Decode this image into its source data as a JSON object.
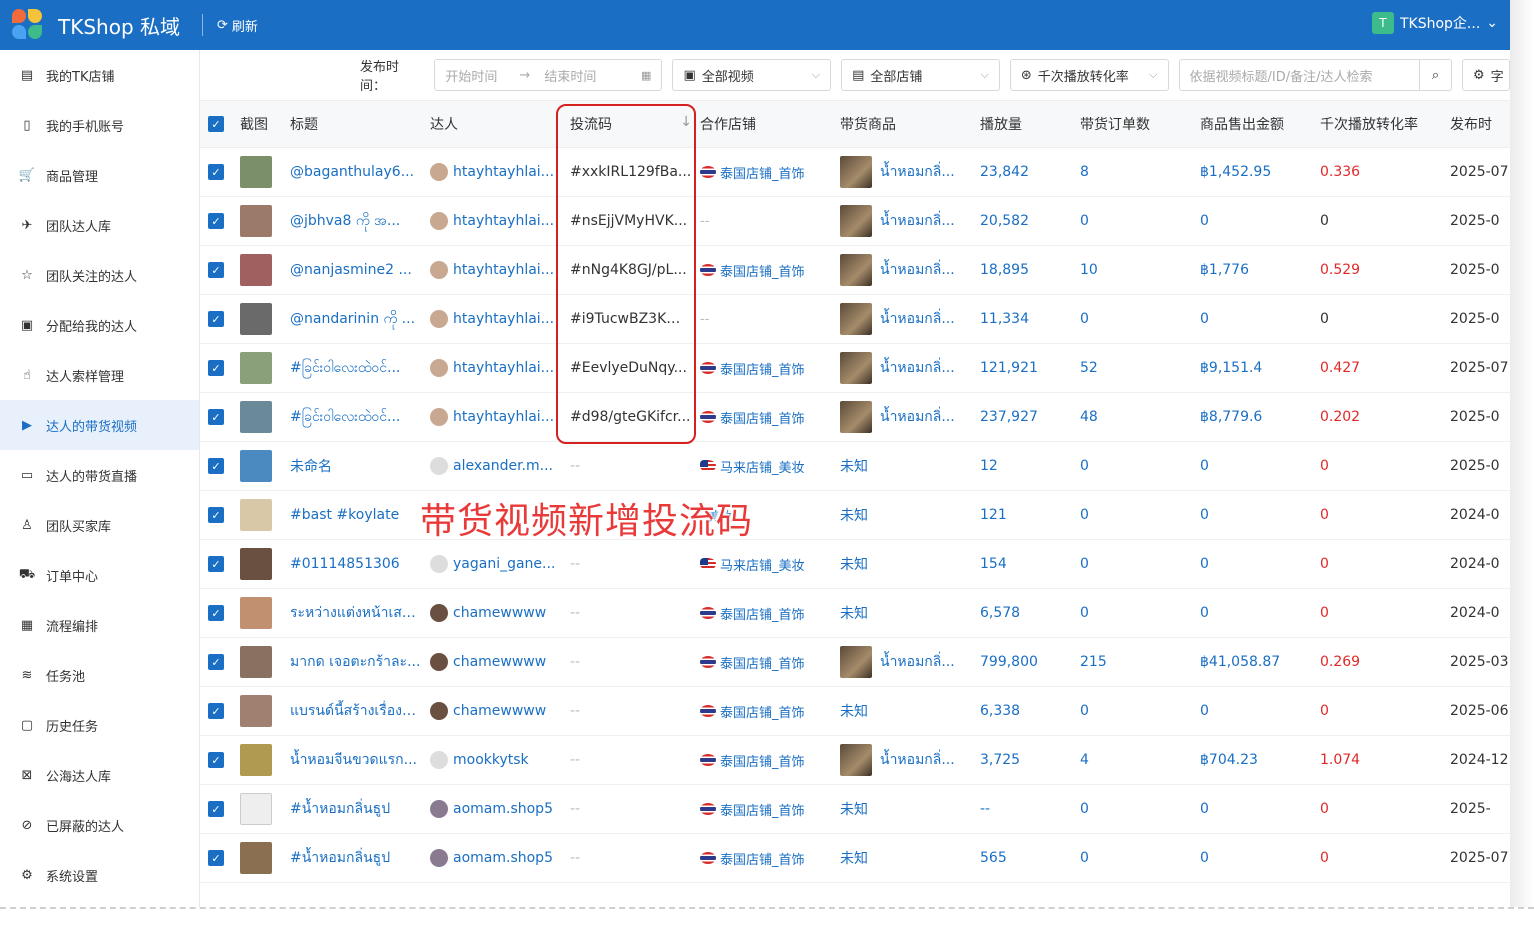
{
  "app": {
    "title": "TKShop 私域",
    "refresh_label": "刷新",
    "user_name": "TKShop企...",
    "user_initial": "T"
  },
  "sidebar": {
    "items": [
      {
        "label": "我的TK店铺",
        "icon": "shop-icon"
      },
      {
        "label": "我的手机账号",
        "icon": "phone-icon"
      },
      {
        "label": "商品管理",
        "icon": "cart-icon"
      },
      {
        "label": "团队达人库",
        "icon": "team-creators-icon"
      },
      {
        "label": "团队关注的达人",
        "icon": "star-icon"
      },
      {
        "label": "分配给我的达人",
        "icon": "assigned-icon"
      },
      {
        "label": "达人索样管理",
        "icon": "hand-icon"
      },
      {
        "label": "达人的带货视频",
        "icon": "video-icon",
        "active": true
      },
      {
        "label": "达人的带货直播",
        "icon": "live-icon"
      },
      {
        "label": "团队买家库",
        "icon": "buyers-icon"
      },
      {
        "label": "订单中心",
        "icon": "truck-icon"
      },
      {
        "label": "流程编排",
        "icon": "calendar-icon"
      },
      {
        "label": "任务池",
        "icon": "layers-icon"
      },
      {
        "label": "历史任务",
        "icon": "clipboard-icon"
      },
      {
        "label": "公海达人库",
        "icon": "public-pool-icon"
      },
      {
        "label": "已屏蔽的达人",
        "icon": "block-icon"
      },
      {
        "label": "系统设置",
        "icon": "settings-icon"
      }
    ]
  },
  "filters": {
    "publish_time_label": "发布时间：",
    "start_placeholder": "开始时间",
    "end_placeholder": "结束时间",
    "video_select": "全部视频",
    "shop_select": "全部店铺",
    "metric_select": "千次播放转化率",
    "search_placeholder": "依据视频标题/ID/备注/达人检索",
    "fields_button": "字"
  },
  "table": {
    "headers": {
      "thumb": "截图",
      "title": "标题",
      "creator": "达人",
      "code": "投流码",
      "shop": "合作店铺",
      "product": "带货商品",
      "views": "播放量",
      "orders": "带货订单数",
      "sales": "商品售出金额",
      "rate": "千次播放转化率",
      "date": "发布时"
    },
    "rows": [
      {
        "title": "@baganthulay6...",
        "creator": "htayhtayhlai...",
        "code": "#xxkIRL129fBa...",
        "shop": "泰国店铺_首饰",
        "flag": "th",
        "product": "น้ำหอมกลิ่...",
        "views": "23,842",
        "orders": "8",
        "sales": "฿1,452.95",
        "rate": "0.336",
        "date": "2025-07"
      },
      {
        "title": "@jbhva8 ကို အ...",
        "creator": "htayhtayhlai...",
        "code": "#nsEjjVMyHVK...",
        "shop": "--",
        "flag": "",
        "product": "น้ำหอมกลิ่...",
        "views": "20,582",
        "orders": "0",
        "sales": "0",
        "rate": "0",
        "date": "2025-0"
      },
      {
        "title": "@nanjasmine2 ...",
        "creator": "htayhtayhlai...",
        "code": "#nNg4K8GJ/pL...",
        "shop": "泰国店铺_首饰",
        "flag": "th",
        "product": "น้ำหอมกลิ่...",
        "views": "18,895",
        "orders": "10",
        "sales": "฿1,776",
        "rate": "0.529",
        "date": "2025-0"
      },
      {
        "title": "@nandarinin ကို ...",
        "creator": "htayhtayhlai...",
        "code": "#i9TucwBZ3Km...",
        "shop": "--",
        "flag": "",
        "product": "น้ำหอมกลิ่...",
        "views": "11,334",
        "orders": "0",
        "sales": "0",
        "rate": "0",
        "date": "2025-0"
      },
      {
        "title": "#ခြင်းဝါလေးထဲဝင်...",
        "creator": "htayhtayhlai...",
        "code": "#EevlyeDuNqy...",
        "shop": "泰国店铺_首饰",
        "flag": "th",
        "product": "น้ำหอมกลิ่...",
        "views": "121,921",
        "orders": "52",
        "sales": "฿9,151.4",
        "rate": "0.427",
        "date": "2025-07"
      },
      {
        "title": "#ခြင်းဝါလေးထဲဝင်...",
        "creator": "htayhtayhlai...",
        "code": "#d98/gteGKifcr...",
        "shop": "泰国店铺_首饰",
        "flag": "th",
        "product": "น้ำหอมกลิ่...",
        "views": "237,927",
        "orders": "48",
        "sales": "฿8,779.6",
        "rate": "0.202",
        "date": "2025-0"
      },
      {
        "title": "未命名",
        "creator": "alexander.m...",
        "code": "--",
        "shop": "马来店铺_美妆",
        "flag": "my",
        "product": "未知",
        "views": "12",
        "orders": "0",
        "sales": "0",
        "rate": "0",
        "date": "2025-0"
      },
      {
        "title": "#bast #koylate",
        "creator": "",
        "code": "",
        "shop": "_美妆",
        "flag": "",
        "product": "未知",
        "views": "121",
        "orders": "0",
        "sales": "0",
        "rate": "0",
        "date": "2024-0"
      },
      {
        "title": "#01114851306",
        "creator": "yagani_gane...",
        "code": "--",
        "shop": "马来店铺_美妆",
        "flag": "my",
        "product": "未知",
        "views": "154",
        "orders": "0",
        "sales": "0",
        "rate": "0",
        "date": "2024-0"
      },
      {
        "title": "ระหว่างแต่งหน้าเสร็...",
        "creator": "chamewwww",
        "code": "--",
        "shop": "泰国店铺_首饰",
        "flag": "th",
        "product": "未知",
        "views": "6,578",
        "orders": "0",
        "sales": "0",
        "rate": "0",
        "date": "2024-0"
      },
      {
        "title": "มากด เจอตะกร้าละ...",
        "creator": "chamewwww",
        "code": "--",
        "shop": "泰国店铺_首饰",
        "flag": "th",
        "product": "น้ำหอมกลิ่...",
        "views": "799,800",
        "orders": "215",
        "sales": "฿41,058.87",
        "rate": "0.269",
        "date": "2025-03"
      },
      {
        "title": "แบรนด์นี้สร้างเรื่องอี...",
        "creator": "chamewwww",
        "code": "--",
        "shop": "泰国店铺_首饰",
        "flag": "th",
        "product": "未知",
        "views": "6,338",
        "orders": "0",
        "sales": "0",
        "rate": "0",
        "date": "2025-06"
      },
      {
        "title": "น้ำหอมจีนขวดแรก...",
        "creator": "mookkytsk",
        "code": "--",
        "shop": "泰国店铺_首饰",
        "flag": "th",
        "product": "น้ำหอมกลิ่...",
        "views": "3,725",
        "orders": "4",
        "sales": "฿704.23",
        "rate": "1.074",
        "date": "2024-12"
      },
      {
        "title": "#น้ำหอมกลิ่นธูป",
        "creator": "aomam.shop5",
        "code": "--",
        "shop": "泰国店铺_首饰",
        "flag": "th",
        "product": "未知",
        "views": "--",
        "orders": "0",
        "sales": "0",
        "rate": "0",
        "date": "2025-"
      },
      {
        "title": "#น้ำหอมกลิ่นธูป",
        "creator": "aomam.shop5",
        "code": "--",
        "shop": "泰国店铺_首饰",
        "flag": "th",
        "product": "未知",
        "views": "565",
        "orders": "0",
        "sales": "0",
        "rate": "0",
        "date": "2025-07"
      }
    ]
  },
  "annotation": {
    "caption": "带货视频新增投流码"
  },
  "colors": {
    "primary": "#1a6fc4",
    "danger": "#e02828",
    "highlight": "#d62020"
  }
}
